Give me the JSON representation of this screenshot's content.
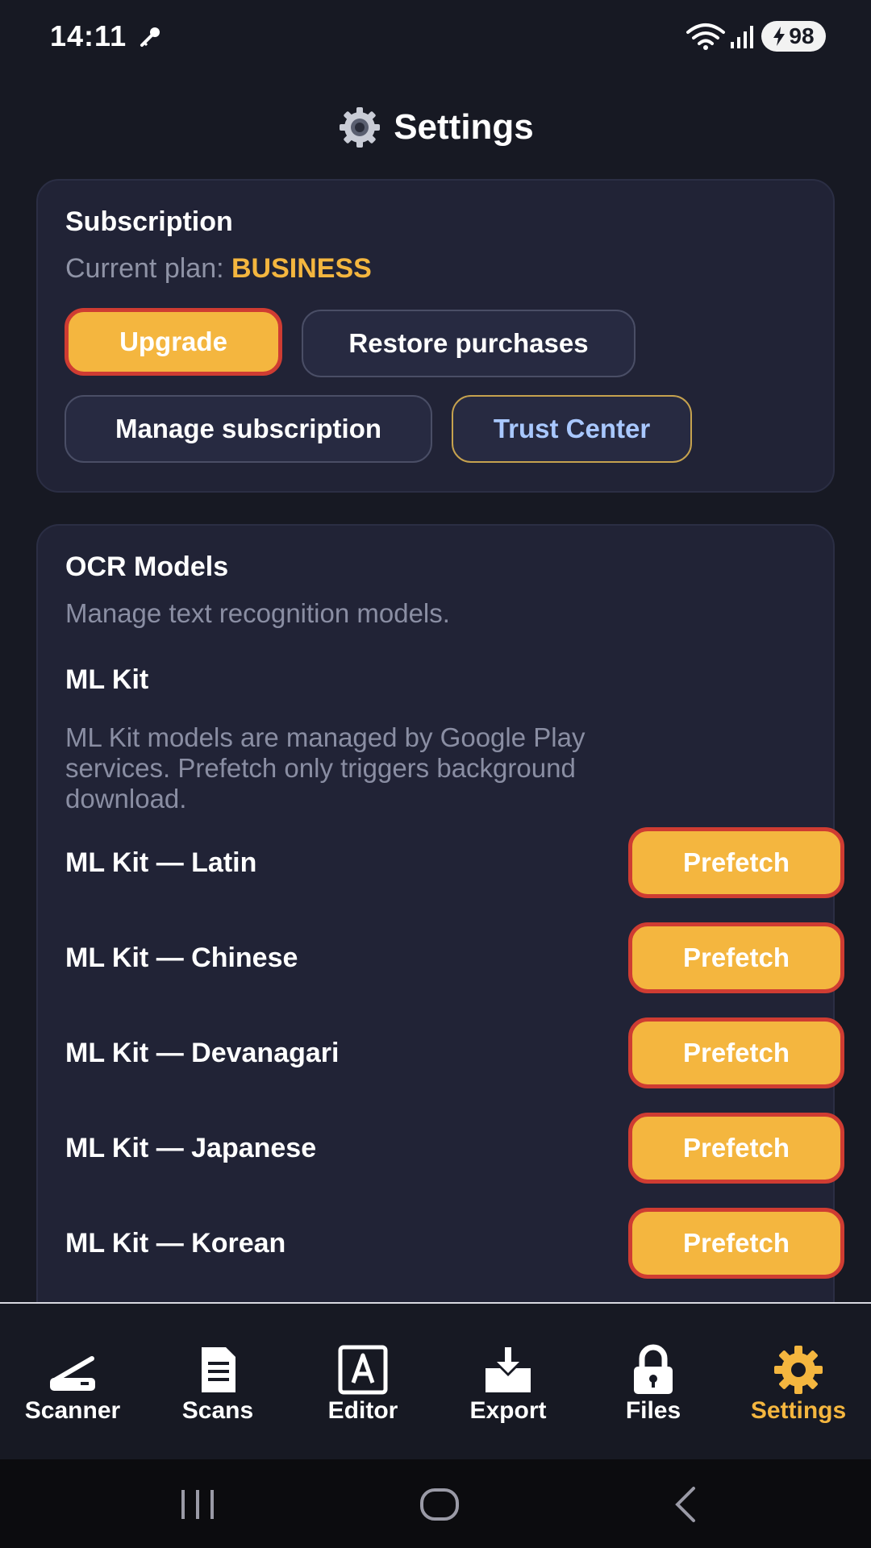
{
  "status_bar": {
    "time": "14:11",
    "battery": "98"
  },
  "header": {
    "title": "Settings"
  },
  "subscription": {
    "title": "Subscription",
    "plan_label": "Current plan:",
    "plan_value": "BUSINESS",
    "upgrade": "Upgrade",
    "restore": "Restore purchases",
    "manage": "Manage subscription",
    "trust": "Trust Center"
  },
  "ocr": {
    "title": "OCR Models",
    "description": "Manage text recognition models.",
    "mlkit_title": "ML Kit",
    "mlkit_line1": "ML Kit models are managed by Google Play",
    "mlkit_line2": "services. Prefetch only triggers background",
    "mlkit_line3": "download.",
    "models": [
      {
        "label": "ML Kit — Latin",
        "action": "Prefetch"
      },
      {
        "label": "ML Kit — Chinese",
        "action": "Prefetch"
      },
      {
        "label": "ML Kit — Devanagari",
        "action": "Prefetch"
      },
      {
        "label": "ML Kit — Japanese",
        "action": "Prefetch"
      },
      {
        "label": "ML Kit — Korean",
        "action": "Prefetch"
      }
    ]
  },
  "nav": {
    "items": [
      {
        "label": "Scanner",
        "icon": "scanner-icon"
      },
      {
        "label": "Scans",
        "icon": "document-icon"
      },
      {
        "label": "Editor",
        "icon": "editor-icon"
      },
      {
        "label": "Export",
        "icon": "export-icon"
      },
      {
        "label": "Files",
        "icon": "lock-icon"
      },
      {
        "label": "Settings",
        "icon": "gear-icon",
        "active": true
      }
    ]
  },
  "colors": {
    "accent": "#f4b63f",
    "accent_border": "#cf3c32",
    "card": "#212336",
    "background": "#171923",
    "trust_text": "#a9c8ff"
  }
}
